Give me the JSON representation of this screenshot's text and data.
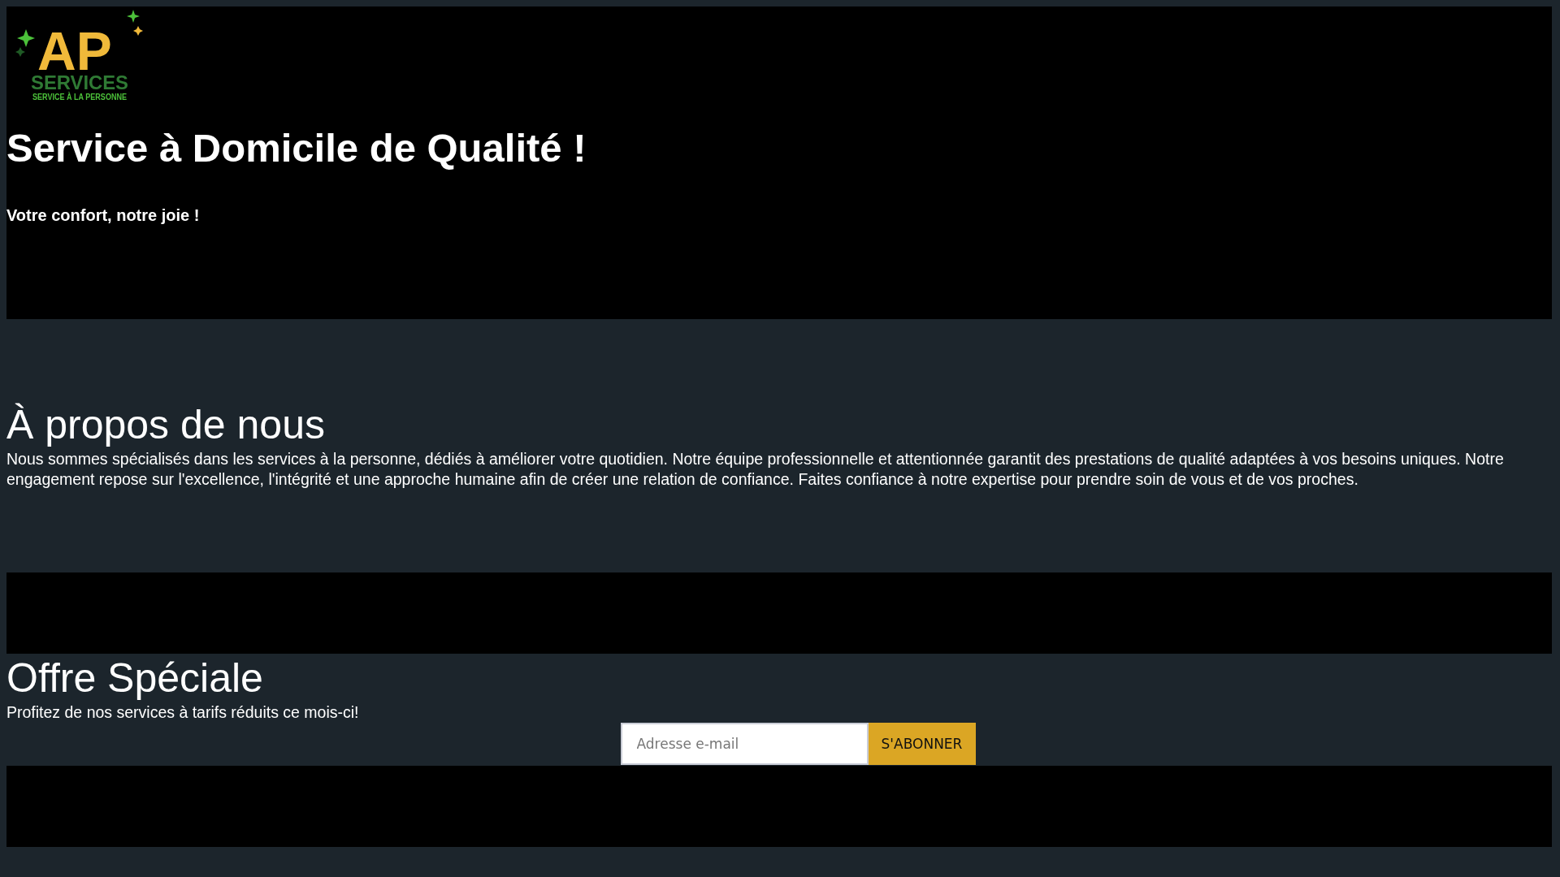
{
  "logo": {
    "mark": "AP",
    "name": "SERVICES",
    "tagline": "SERVICE À LA PERSONNE"
  },
  "hero": {
    "title": "Service à Domicile de Qualité !",
    "subtitle": "Votre confort, notre joie !"
  },
  "about": {
    "title": "À propos de nous",
    "text": "Nous sommes spécialisés dans les services à la personne, dédiés à améliorer votre quotidien. Notre équipe professionnelle et attentionnée garantit des prestations de qualité adaptées à vos besoins uniques. Notre engagement repose sur l'excellence, l'intégrité et une approche humaine afin de créer une relation de confiance. Faites confiance à notre expertise pour prendre soin de vous et de vos proches."
  },
  "offer": {
    "title": "Offre Spéciale",
    "text": "Profitez de nos services à tarifs réduits ce mois-ci!",
    "email": {
      "placeholder": "Adresse e-mail"
    },
    "button": "S'ABONNER"
  }
}
